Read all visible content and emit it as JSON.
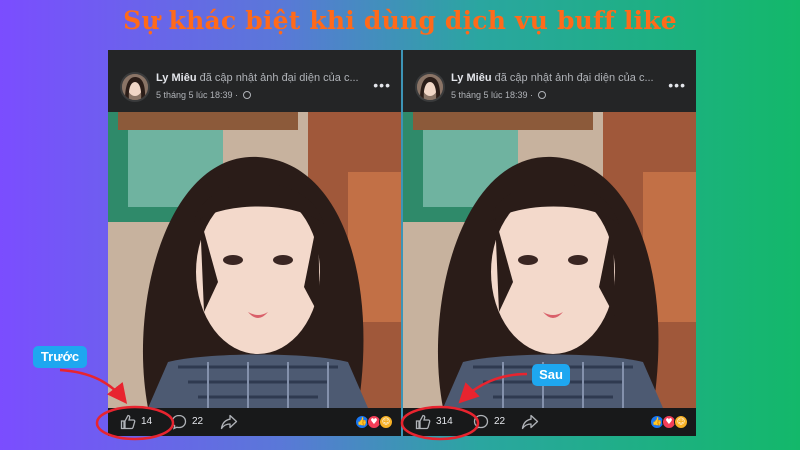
{
  "headline": "Sự khác biệt khi dùng dịch vụ buff like",
  "tags": {
    "before": "Trước",
    "after": "Sau"
  },
  "posts": {
    "before": {
      "author": "Ly Miêu",
      "action": "đã cập nhật ảnh đại diện của c...",
      "timestamp": "5 tháng 5 lúc 18:39 ·",
      "likes": "14",
      "comments": "22"
    },
    "after": {
      "author": "Ly Miêu",
      "action": "đã cập nhật ảnh đại diện của c...",
      "timestamp": "5 tháng 5 lúc 18:39 ·",
      "likes": "314",
      "comments": "22"
    }
  },
  "icons": {
    "more": "more-options-icon",
    "privacy": "globe-icon",
    "like": "thumbs-up-icon",
    "comment": "comment-bubble-icon",
    "share": "share-arrow-icon",
    "reactions": [
      "like-reaction-icon",
      "love-reaction-icon",
      "haha-reaction-icon"
    ]
  },
  "colors": {
    "headline": "#ff6a1a",
    "tag": "#1ea7f0",
    "highlight": "#e8242f",
    "card": "#242526",
    "footer": "#18191a"
  }
}
